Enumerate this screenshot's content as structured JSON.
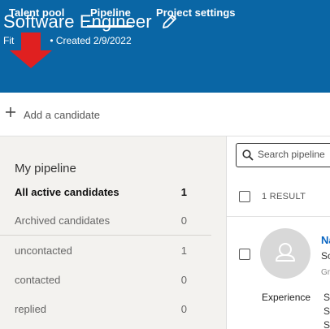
{
  "header": {
    "title": "Software Engineer",
    "subtitle_left": "Fit",
    "created": "• Created 2/9/2022",
    "tabs": [
      {
        "label": "Talent pool"
      },
      {
        "label": "Pipeline"
      },
      {
        "label": "Project settings"
      }
    ],
    "active_tab": "Pipeline"
  },
  "toolbar": {
    "add_candidate_label": "Add a candidate"
  },
  "pipeline": {
    "title": "My pipeline",
    "rows": [
      {
        "label": "All active candidates",
        "count": "1"
      },
      {
        "label": "Archived candidates",
        "count": "0"
      },
      {
        "label": "uncontacted",
        "count": "1"
      },
      {
        "label": "contacted",
        "count": "0"
      },
      {
        "label": "replied",
        "count": "0"
      }
    ]
  },
  "results": {
    "search_placeholder": "Search pipeline",
    "count_label": "1 RESULT",
    "candidate": {
      "name": "Na",
      "line1": "So",
      "line2": "Gr",
      "experience_label": "Experience",
      "experience_lines": [
        "So",
        "So",
        "Sc"
      ]
    }
  },
  "colors": {
    "header_bg": "#0a66a5",
    "annotation_arrow": "#e02020",
    "link": "#0a66c2",
    "panel_bg": "#f3f2ef"
  }
}
